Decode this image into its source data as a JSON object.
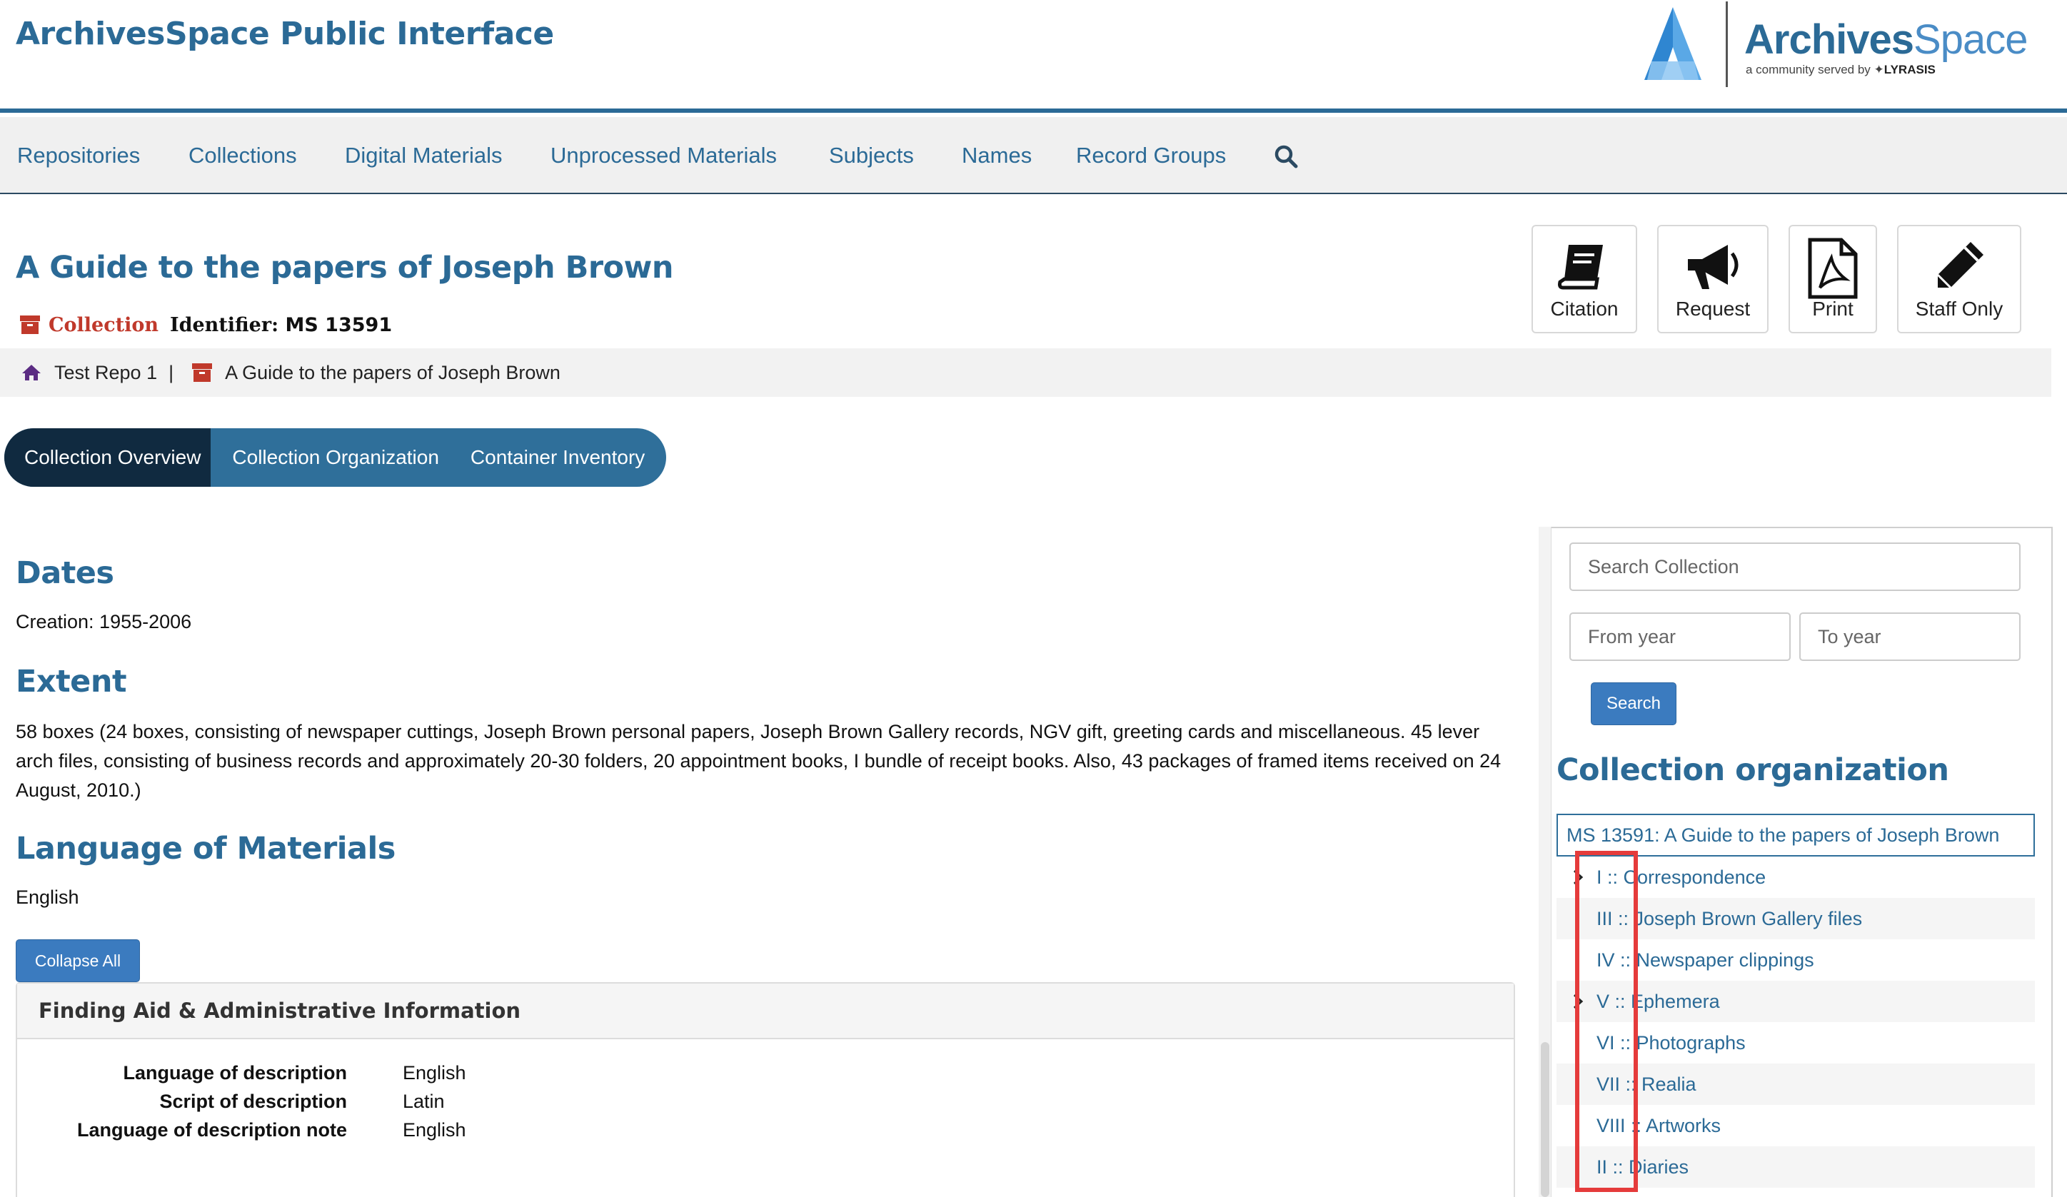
{
  "header": {
    "site_title": "ArchivesSpace Public Interface",
    "logo_word_bold": "Archives",
    "logo_word_light": "Space",
    "logo_sub_text": "a community served by",
    "logo_sub_brand": "LYRASIS"
  },
  "nav": {
    "items": [
      {
        "label": "Repositories"
      },
      {
        "label": "Collections"
      },
      {
        "label": "Digital Materials"
      },
      {
        "label": "Unprocessed Materials"
      },
      {
        "label": "Subjects"
      },
      {
        "label": "Names"
      },
      {
        "label": "Record Groups"
      }
    ],
    "search_icon": "search-icon"
  },
  "record": {
    "title": "A Guide to the papers of Joseph Brown",
    "type_label": "Collection",
    "identifier_label": "Identifier:",
    "identifier_value": "MS 13591"
  },
  "breadcrumb": {
    "repo": "Test Repo 1",
    "separator": "|",
    "current": "A Guide to the papers of Joseph Brown"
  },
  "actions": {
    "citation": "Citation",
    "request": "Request",
    "print": "Print",
    "staff_only": "Staff Only"
  },
  "tabs": {
    "overview": "Collection Overview",
    "organization": "Collection Organization",
    "inventory": "Container Inventory"
  },
  "main": {
    "dates_heading": "Dates",
    "dates_text": "Creation: 1955-2006",
    "extent_heading": "Extent",
    "extent_text": "58 boxes (24 boxes, consisting of newspaper cuttings, Joseph Brown personal papers, Joseph Brown Gallery records, NGV gift, greeting cards and miscellaneous. 45 lever arch files, consisting of business records and approximately 20-30 folders, 20 appointment books, I bundle of receipt books. Also, 43 packages of framed items received on 24 August, 2010.)",
    "language_heading": "Language of Materials",
    "language_text": "English",
    "collapse_all": "Collapse All"
  },
  "finding_aid": {
    "heading": "Finding Aid & Administrative Information",
    "rows": [
      {
        "key": "Language of description",
        "value": "English"
      },
      {
        "key": "Script of description",
        "value": "Latin"
      },
      {
        "key": "Language of description note",
        "value": "English"
      }
    ]
  },
  "sidebar": {
    "search_placeholder": "Search Collection",
    "from_year_placeholder": "From year",
    "to_year_placeholder": "To year",
    "search_button": "Search",
    "org_heading": "Collection organization",
    "tree_root": "MS 13591: A Guide to the papers of Joseph Brown",
    "tree_items": [
      {
        "label": "I :: Correspondence",
        "expandable": true
      },
      {
        "label": "III :: Joseph Brown Gallery files",
        "expandable": false
      },
      {
        "label": "IV :: Newspaper clippings",
        "expandable": false
      },
      {
        "label": "V :: Ephemera",
        "expandable": true
      },
      {
        "label": "VI :: Photographs",
        "expandable": false
      },
      {
        "label": "VII :: Realia",
        "expandable": false
      },
      {
        "label": "VIII :: Artworks",
        "expandable": false
      },
      {
        "label": "II :: Diaries",
        "expandable": false
      }
    ]
  },
  "colors": {
    "brand_blue": "#2b6a96",
    "tab_active": "#102a40",
    "tab_bg": "#2f6f9a",
    "collection_red": "#c0392b",
    "highlight_red": "#e53b3b"
  }
}
